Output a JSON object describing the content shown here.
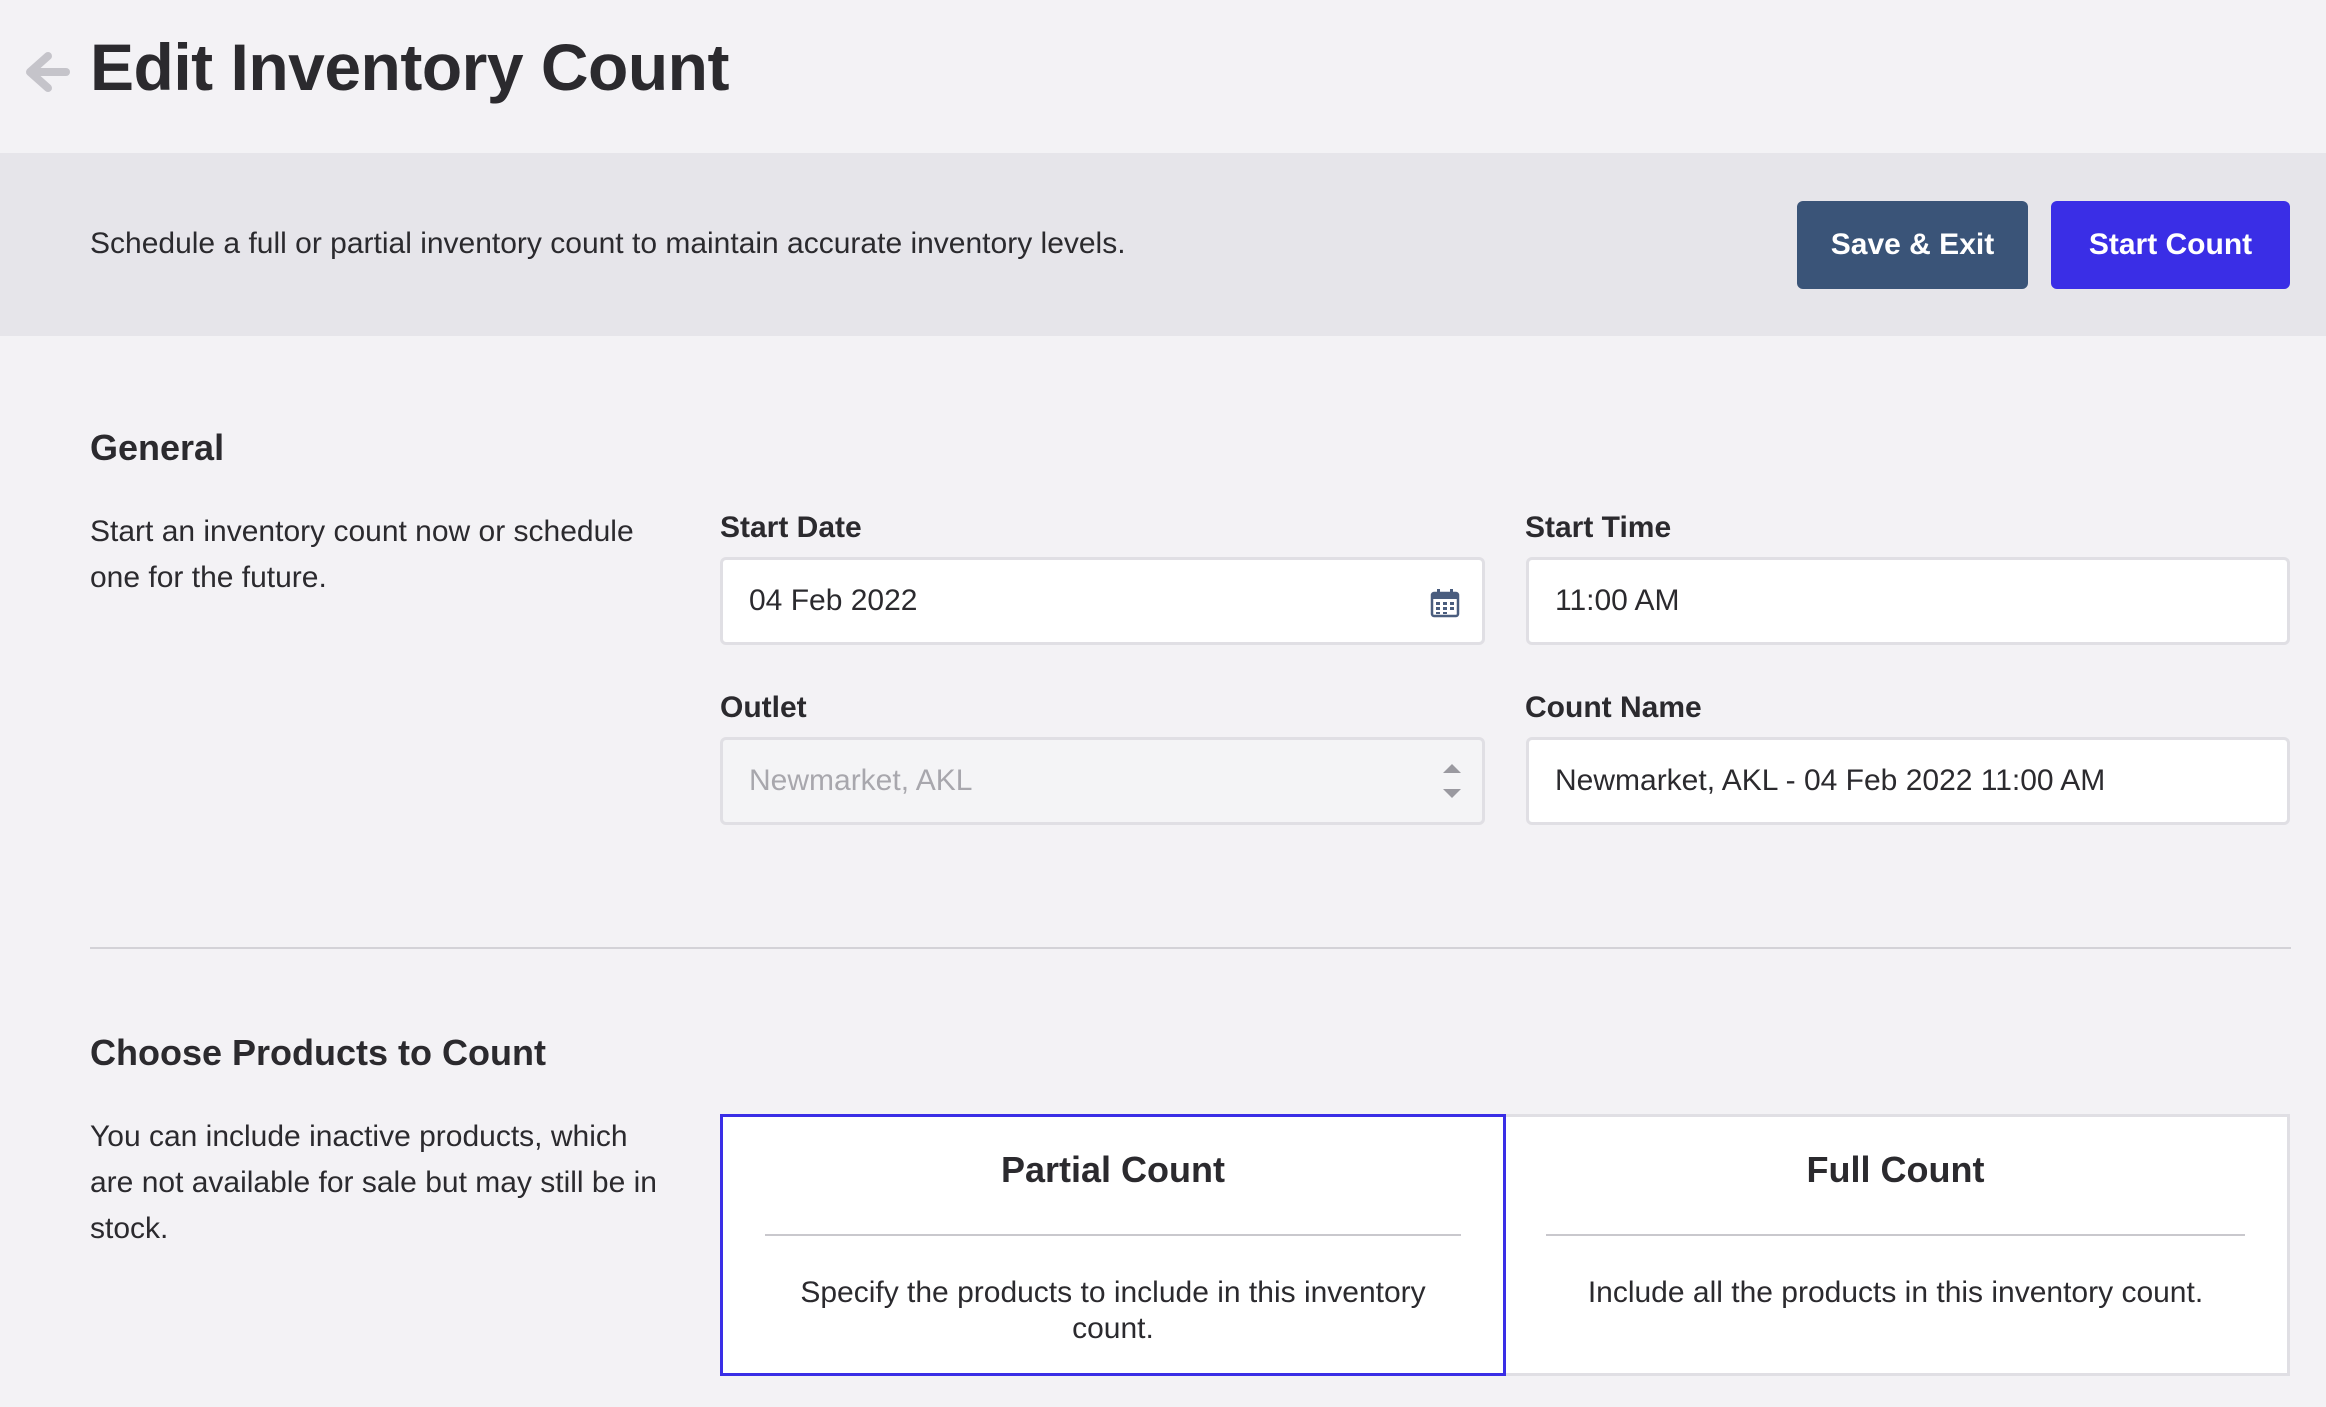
{
  "header": {
    "title": "Edit Inventory Count",
    "back_icon": "arrow-left-icon"
  },
  "action_bar": {
    "description": "Schedule a full or partial inventory count to maintain accurate inventory levels.",
    "save_exit_label": "Save & Exit",
    "start_count_label": "Start Count"
  },
  "general": {
    "title": "General",
    "description": "Start an inventory count now or schedule one for the future.",
    "start_date": {
      "label": "Start Date",
      "value": "04 Feb 2022",
      "icon": "calendar-icon"
    },
    "start_time": {
      "label": "Start Time",
      "value": "11:00 AM"
    },
    "outlet": {
      "label": "Outlet",
      "value": "Newmarket, AKL",
      "disabled": true
    },
    "count_name": {
      "label": "Count Name",
      "value": "Newmarket, AKL - 04 Feb 2022 11:00 AM"
    }
  },
  "choose_products": {
    "title": "Choose Products to Count",
    "description": "You can include inactive products, which are not available for sale but may still be in stock.",
    "options": [
      {
        "title": "Partial Count",
        "description": "Specify the products to include in this inventory count.",
        "selected": true
      },
      {
        "title": "Full Count",
        "description": "Include all the products in this inventory count.",
        "selected": false
      }
    ]
  },
  "colors": {
    "accent": "#3a2ee6",
    "save_button": "#3a5478",
    "background": "#f3f2f5",
    "action_bar": "#e6e5ea"
  }
}
